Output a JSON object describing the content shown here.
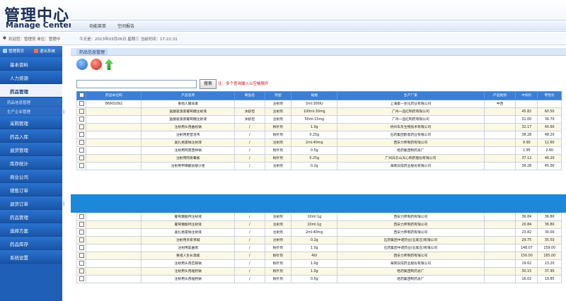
{
  "header": {
    "logo_cn": "管理中心",
    "logo_en": "Manage Center",
    "nav_tabs": [
      "功能菜单",
      "空间报告"
    ]
  },
  "infobar": {
    "user_text": "欢迎您：管理员 单位：管理中",
    "time_text": "今天是：2013年03月06日 星期三 当前时间：17:22:31"
  },
  "sidebar": {
    "top_buttons": [
      "管理首页",
      "退出系统"
    ],
    "items": [
      {
        "label": "基本资料",
        "type": "item"
      },
      {
        "label": "人力资源",
        "type": "item"
      },
      {
        "label": "药品管理",
        "type": "active"
      },
      {
        "label": "药品信息管理",
        "type": "sub"
      },
      {
        "label": "生产企业管理",
        "type": "sub"
      },
      {
        "label": "采购管理",
        "type": "item"
      },
      {
        "label": "药品入库",
        "type": "item"
      },
      {
        "label": "退货管理",
        "type": "item"
      },
      {
        "label": "库存统计",
        "type": "item"
      },
      {
        "label": "商业公司",
        "type": "item"
      },
      {
        "label": "销售订单",
        "type": "item"
      },
      {
        "label": "退货订单",
        "type": "item"
      },
      {
        "label": "药品管理",
        "type": "item"
      },
      {
        "label": "选择方案",
        "type": "item"
      },
      {
        "label": "药品库存",
        "type": "item"
      },
      {
        "label": "系统设置",
        "type": "item"
      }
    ]
  },
  "main": {
    "panel_title": "药品信息管理",
    "search": {
      "button": "搜索",
      "hint": "注：多个查询输入以空格隔开",
      "value": ""
    },
    "columns": [
      "",
      "药品本位码",
      "产品名称",
      "商品名",
      "剂型",
      "规格",
      "生产厂家",
      "产品类别",
      "中标价",
      "零售价"
    ],
    "rows_top": [
      [
        "",
        "86901092",
        "重组人胰岛素",
        "",
        "注射剂",
        "3ml:300IU",
        "上海第一生化药业有限公司",
        "中西",
        "",
        ""
      ],
      [
        "",
        "",
        "盐酸氨溴索葡萄糖注射液",
        "沐舒坦",
        "注射剂",
        "100ml:30mg",
        "广州一品红制药有限公司",
        "",
        "45.82",
        "60.50"
      ],
      [
        "",
        "",
        "盐酸氨溴索葡萄糖注射液",
        "沐舒坦",
        "注射剂",
        "50ml:15mg",
        "广州一品红制药有限公司",
        "",
        "31.00",
        "36.70"
      ],
      [
        "",
        "",
        "注射用头孢曲松钠",
        "/",
        "粉针剂",
        "1.0g",
        "杭州华东生物技术有限公司",
        "",
        "32.17",
        "40.60"
      ],
      [
        "",
        "",
        "注射用更昔洛韦",
        "/",
        "粉针剂",
        "0.25g",
        "石药集团欧意药业有限公司",
        "",
        "38.28",
        "48.20"
      ],
      [
        "",
        "",
        "奥扎格雷钠注射液",
        "/",
        "注射剂",
        "2ml:40mg",
        "西安力邦制药有限公司",
        "",
        "9.90",
        "12.60"
      ],
      [
        "",
        "",
        "注射用阿莫西林钠",
        "/",
        "粉针剂",
        "0.5g",
        "哈药集团制药总厂",
        "",
        "1.95",
        "2.60"
      ],
      [
        "",
        "",
        "注射用阿奇霉素",
        "/",
        "粉针剂",
        "0.25g",
        "广州白云山天心制药股份有限公司",
        "",
        "37.12",
        "46.20"
      ],
      [
        "",
        "",
        "注射用甲磺酸加替沙星",
        "/",
        "注射剂",
        "0.2g",
        "海南双成药业股份有限公司",
        "",
        "36.28",
        "45.00"
      ]
    ],
    "rows_bottom": [
      [
        "",
        "",
        "葡萄糖酸钙注射液",
        "/",
        "注射剂",
        "10ml:1g",
        "西安力邦制药有限公司",
        "",
        "36.84",
        "36.80"
      ],
      [
        "",
        "",
        "葡萄糖酸钙注射液",
        "/",
        "注射剂",
        "10ml:1g",
        "西安力邦制药有限公司",
        "",
        "20.84",
        "36.80"
      ],
      [
        "",
        "",
        "奥扎格雷钠注射液",
        "/",
        "注射剂",
        "2ml:40mg",
        "西安力邦制药有限公司",
        "",
        "23.82",
        "30.00"
      ],
      [
        "",
        "",
        "注射用多索茶碱",
        "/",
        "注射剂",
        "0.2g",
        "石药集团中诺药业(石家庄)有限公司",
        "",
        "29.75",
        "35.50"
      ],
      [
        "",
        "",
        "注射用氨曲南",
        "/",
        "粉针剂",
        "1.0g",
        "石药集团中诺药业(石家庄)有限公司",
        "",
        "148.07",
        "159.00"
      ],
      [
        "",
        "",
        "重组人生长激素",
        "/",
        "粉针剂",
        "4IU",
        "西安力邦制药有限公司",
        "",
        "150.00",
        "185.00"
      ],
      [
        "",
        "",
        "注射用头孢匹胺钠",
        "/",
        "粉针剂",
        "1.0g",
        "海南双成药业股份有限公司",
        "",
        "19.62",
        "23.20"
      ],
      [
        "",
        "",
        "注射用头孢唑肟钠",
        "/",
        "粉针剂",
        "1.0g",
        "哈药集团制药总厂",
        "",
        "30.15",
        "37.90"
      ],
      [
        "",
        "",
        "注射用头孢唑肟钠",
        "/",
        "粉针剂",
        "0.5g",
        "哈药集团制药总厂",
        "",
        "16.02",
        "19.85"
      ]
    ]
  }
}
